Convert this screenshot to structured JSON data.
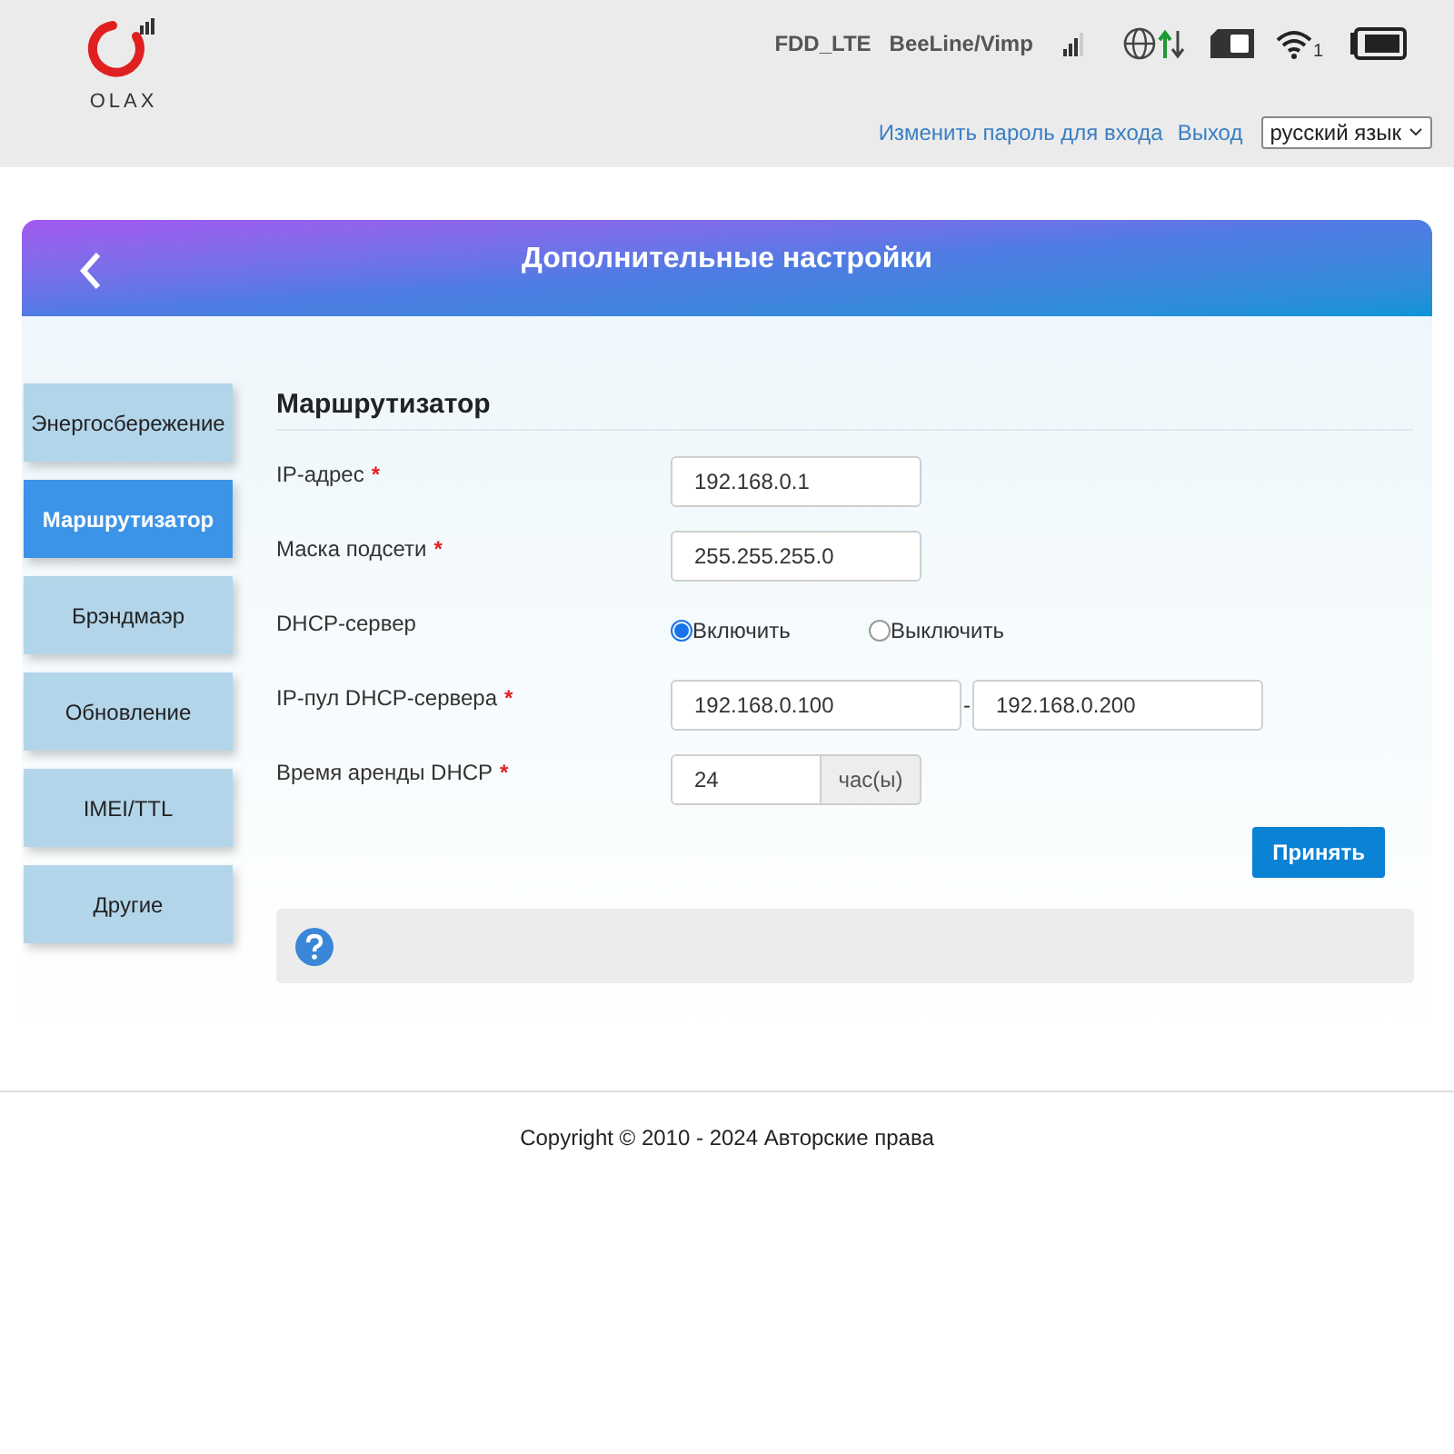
{
  "header": {
    "logo_text": "OLAX",
    "network_type": "FDD_LTE",
    "operator": "BeeLine/Vimp",
    "wifi_clients": "1",
    "links": [
      {
        "label": "Изменить пароль для входа"
      },
      {
        "label": "Выход"
      }
    ],
    "language": "русский язык"
  },
  "panel": {
    "title": "Дополнительные настройки"
  },
  "sidebar": {
    "items": [
      {
        "label": "Энергосбережение",
        "selected": false
      },
      {
        "label": "Маршрутизатор",
        "selected": true
      },
      {
        "label": "Брэндмаэр",
        "selected": false
      },
      {
        "label": "Обновление",
        "selected": false
      },
      {
        "label": "IMEI/TTL",
        "selected": false
      },
      {
        "label": "Другие",
        "selected": false
      }
    ]
  },
  "form": {
    "title": "Маршрутизатор",
    "fields": [
      {
        "kind": "text",
        "label": "IP-адрес",
        "required_mark": "*",
        "value": "192.168.0.1"
      },
      {
        "kind": "text",
        "label": "Маска подсети",
        "required_mark": "*",
        "value": "255.255.255.0"
      },
      {
        "kind": "radio",
        "label": "DHCP-сервер",
        "options": [
          {
            "label": "Включить",
            "selected": true
          },
          {
            "label": "Выключить",
            "selected": false
          }
        ]
      },
      {
        "kind": "range",
        "label": "IP-пул DHCP-сервера",
        "required_mark": "*",
        "value": "192.168.0.100",
        "separator": "-",
        "value_end": "192.168.0.200"
      },
      {
        "kind": "unit",
        "label": "Время аренды DHCP",
        "required_mark": "*",
        "value": "24",
        "unit": "час(ы)"
      }
    ],
    "submit": "Принять"
  },
  "footer": {
    "copyright": "Copyright © 2010 - 2024 Авторские права"
  }
}
